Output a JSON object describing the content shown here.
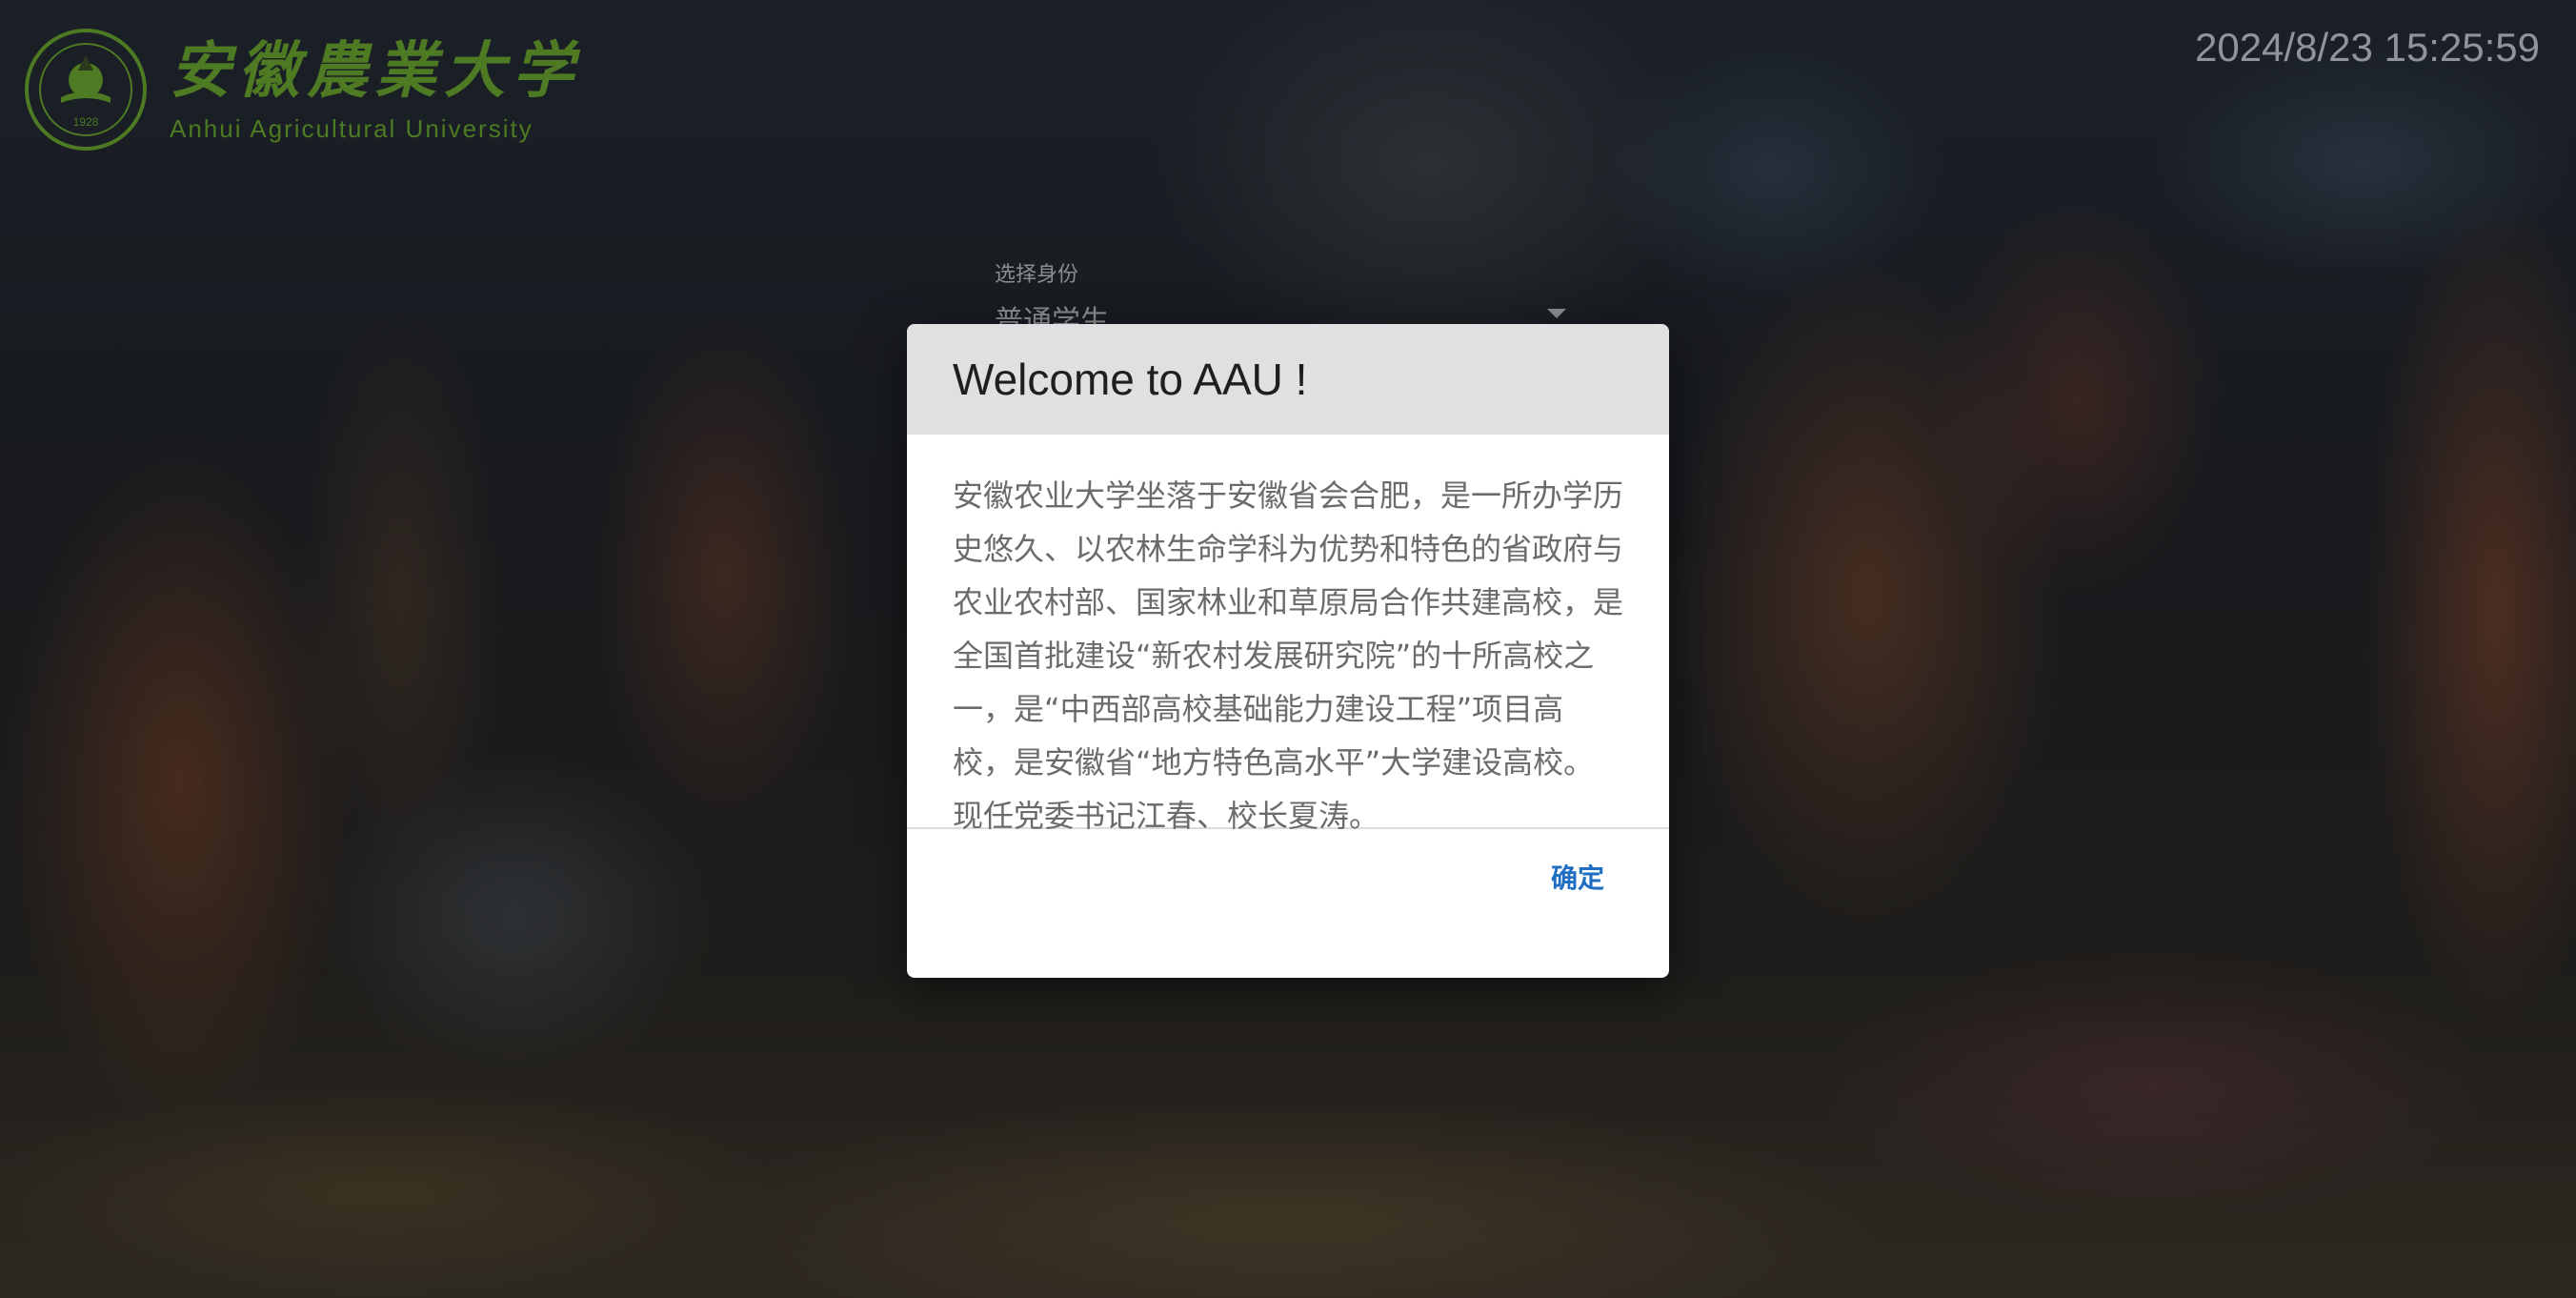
{
  "header": {
    "university_name_cn": "安徽農業大学",
    "university_name_en": "Anhui Agricultural University",
    "seal_year": "1928",
    "logo_color": "#4d7a22",
    "datetime": "2024/8/23 15:25:59"
  },
  "login_form": {
    "identity_label": "选择身份",
    "identity_value": "普通学生"
  },
  "dialog": {
    "title": "Welcome to AAU !",
    "body": "安徽农业大学坐落于安徽省会合肥，是一所办学历史悠久、以农林生命学科为优势和特色的省政府与农业农村部、国家林业和草原局合作共建高校，是全国首批建设“新农村发展研究院”的十所高校之一，是“中西部高校基础能力建设工程”项目高校，是安徽省“地方特色高水平”大学建设高校。现任党委书记江春、校长夏涛。",
    "confirm_label": "确定",
    "accent_color": "#1e6fc4"
  }
}
